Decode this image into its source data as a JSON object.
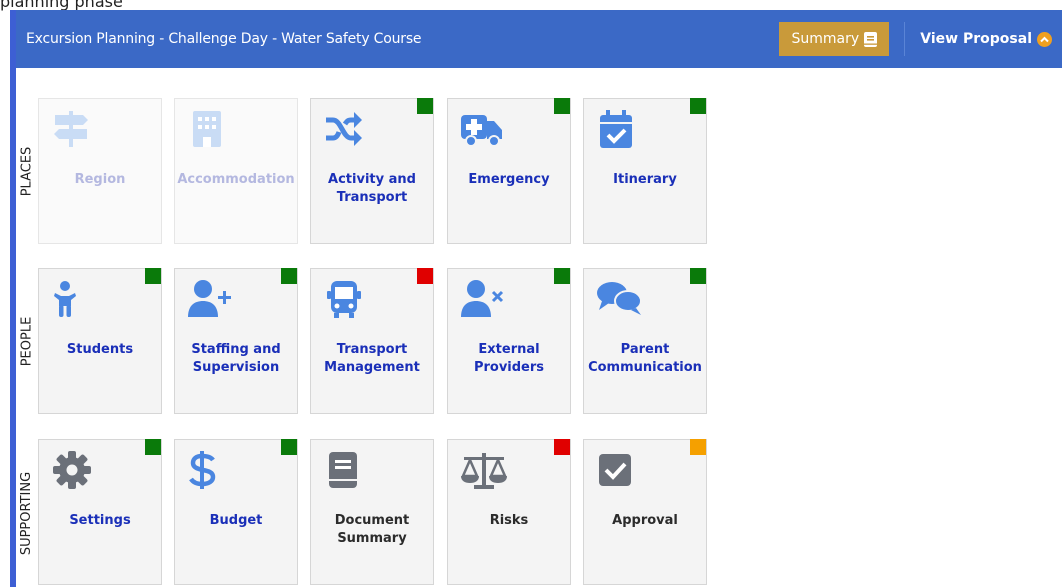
{
  "page": {
    "top_text": "planning phase"
  },
  "header": {
    "title": "Excursion Planning - Challenge Day - Water Safety Course",
    "summary_label": "Summary",
    "view_proposal_label": "View Proposal"
  },
  "colors": {
    "header": "#3b69c6",
    "summary": "#c99a3a",
    "green": "#0a7a0a",
    "red": "#e00000",
    "orange": "#f5a000",
    "icon_blue": "#4a86e0",
    "icon_gray": "#6b7079"
  },
  "sections": [
    {
      "label": "PLACES",
      "tiles": [
        {
          "label": "Region",
          "icon": "signpost-icon",
          "status": null,
          "disabled": true
        },
        {
          "label": "Accommodation",
          "icon": "building-icon",
          "status": null,
          "disabled": true
        },
        {
          "label": "Activity and Transport",
          "icon": "shuffle-icon",
          "status": "green"
        },
        {
          "label": "Emergency",
          "icon": "ambulance-icon",
          "status": "green"
        },
        {
          "label": "Itinerary",
          "icon": "calendar-check-icon",
          "status": "green"
        }
      ]
    },
    {
      "label": "PEOPLE",
      "tiles": [
        {
          "label": "Students",
          "icon": "child-icon",
          "status": "green"
        },
        {
          "label": "Staffing and Supervision",
          "icon": "user-plus-icon",
          "status": "green"
        },
        {
          "label": "Transport Management",
          "icon": "bus-icon",
          "status": "red"
        },
        {
          "label": "External Providers",
          "icon": "user-times-icon",
          "status": "green"
        },
        {
          "label": "Parent Communication",
          "icon": "comments-icon",
          "status": "green"
        }
      ]
    },
    {
      "label": "SUPPORTING",
      "tiles": [
        {
          "label": "Settings",
          "icon": "gear-icon",
          "status": "green"
        },
        {
          "label": "Budget",
          "icon": "dollar-icon",
          "status": "green"
        },
        {
          "label": "Document Summary",
          "icon": "book-icon",
          "status": null
        },
        {
          "label": "Risks",
          "icon": "balance-scale-icon",
          "status": "red"
        },
        {
          "label": "Approval",
          "icon": "check-square-icon",
          "status": "orange"
        }
      ]
    }
  ]
}
